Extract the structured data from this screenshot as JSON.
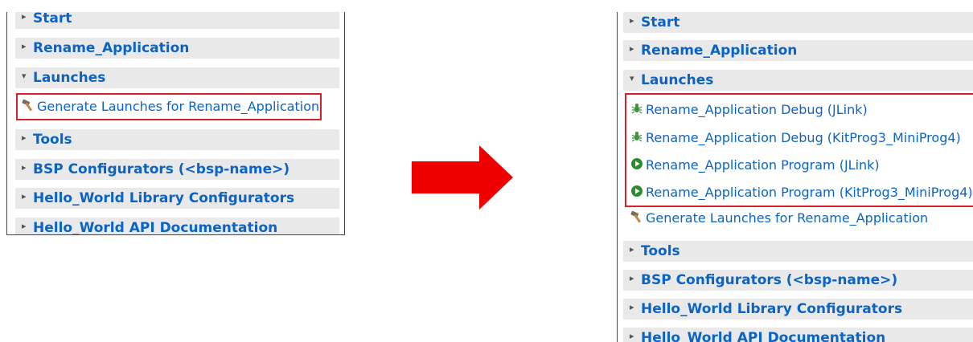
{
  "before": {
    "sections": {
      "start": "Start",
      "rename_application": "Rename_Application",
      "launches": "Launches",
      "tools": "Tools",
      "bsp_configurators": "BSP Configurators (<bsp-name>)",
      "library_configurators": "Hello_World Library Configurators",
      "api_documentation": "Hello_World API Documentation"
    },
    "launch_items": [
      {
        "label": "Generate Launches for Rename_Application",
        "icon": "hammer-icon"
      }
    ]
  },
  "after": {
    "sections": {
      "start": "Start",
      "rename_application": "Rename_Application",
      "launches": "Launches",
      "tools": "Tools",
      "bsp_configurators": "BSP Configurators (<bsp-name>)",
      "library_configurators": "Hello_World Library Configurators",
      "api_documentation": "Hello_World API Documentation"
    },
    "launch_items": [
      {
        "label": "Rename_Application Debug (JLink)",
        "icon": "debug-bug-icon"
      },
      {
        "label": "Rename_Application Debug (KitProg3_MiniProg4)",
        "icon": "debug-bug-icon"
      },
      {
        "label": "Rename_Application Program (JLink)",
        "icon": "run-program-icon"
      },
      {
        "label": "Rename_Application Program (KitProg3_MiniProg4)",
        "icon": "run-program-icon"
      },
      {
        "label": "Generate Launches for Rename_Application",
        "icon": "hammer-icon"
      }
    ]
  },
  "colors": {
    "link": "#0a64c8",
    "section_bg": "#e9e9e9",
    "highlight": "#d6202a",
    "arrow": "#ee0000"
  }
}
